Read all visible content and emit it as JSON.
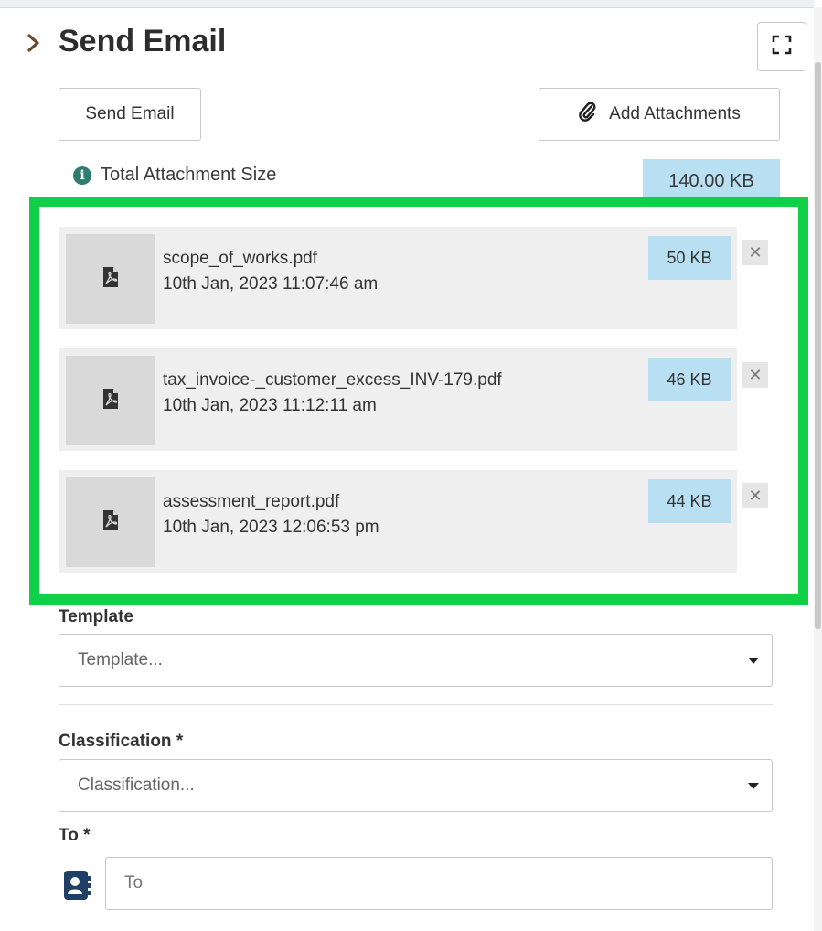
{
  "panel": {
    "title": "Send Email",
    "send_button_label": "Send Email",
    "add_attachments_label": "Add Attachments",
    "total_attachment_label": "Total Attachment Size",
    "total_attachment_size": "140.00 KB"
  },
  "attachments": [
    {
      "name": "scope_of_works.pdf",
      "date": "10th Jan, 2023 11:07:46 am",
      "size": "50 KB"
    },
    {
      "name": "tax_invoice-_customer_excess_INV-179.pdf",
      "date": "10th Jan, 2023 11:12:11 am",
      "size": "46 KB"
    },
    {
      "name": "assessment_report.pdf",
      "date": "10th Jan, 2023 12:06:53 pm",
      "size": "44 KB"
    }
  ],
  "form": {
    "template_label": "Template",
    "template_placeholder": "Template...",
    "classification_label": "Classification *",
    "classification_placeholder": "Classification...",
    "to_label": "To *",
    "to_placeholder": "To"
  },
  "icons": {
    "collapse": "chevron-right-icon",
    "expand": "fullscreen-icon",
    "attach": "paperclip-icon",
    "info": "info-icon",
    "file": "pdf-file-icon",
    "remove": "close-icon",
    "contacts": "address-book-icon"
  },
  "colors": {
    "highlight": "#11d047",
    "size_badge": "#b9dff3",
    "info": "#2e7d6e",
    "contact_icon": "#1f3f66"
  }
}
